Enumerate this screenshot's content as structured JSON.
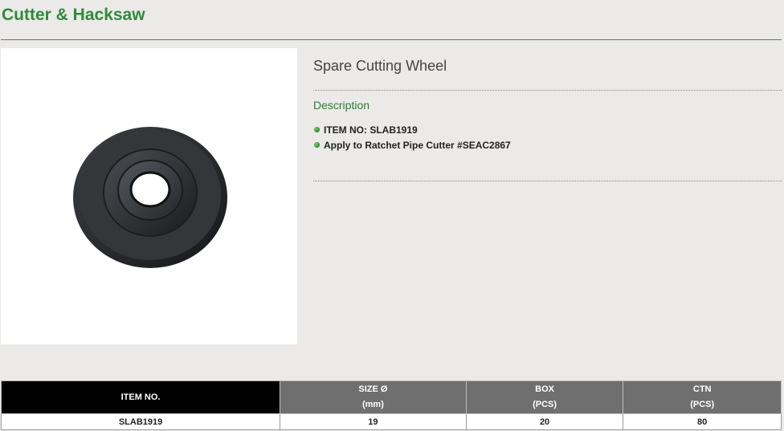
{
  "category": {
    "title": "Cutter & Hacksaw"
  },
  "product": {
    "name": "Spare Cutting Wheel",
    "image_icon": "cutting-wheel-image",
    "description_heading": "Description",
    "description_items": [
      "ITEM NO: SLAB1919",
      "Apply to Ratchet Pipe Cutter #SEAC2867"
    ]
  },
  "spec_table": {
    "headers": [
      {
        "line1": "ITEM NO.",
        "line2": ""
      },
      {
        "line1": "SIZE Ø",
        "line2": "(mm)"
      },
      {
        "line1": "BOX",
        "line2": "(PCS)"
      },
      {
        "line1": "CTN",
        "line2": "(PCS)"
      }
    ],
    "rows": [
      [
        "SLAB1919",
        "19",
        "20",
        "80"
      ]
    ]
  },
  "colors": {
    "accent_green": "#2e8a3a",
    "page_background": "#ebeae8",
    "header_black": "#000000",
    "header_gray": "#6f6f6f"
  }
}
